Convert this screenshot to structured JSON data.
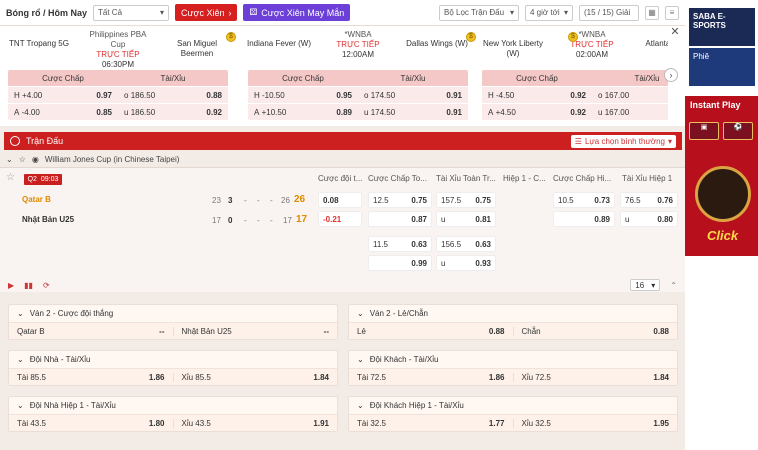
{
  "topbar": {
    "breadcrumb": "Bóng rổ / Hôm Nay",
    "filter_all": "Tất Cả",
    "parlay_btn": "Cược Xiên",
    "lucky_parlay_btn": "Cược Xiên May Mắn",
    "match_filter": "Bộ Lọc Trận Đấu",
    "hours": "4 giờ tới",
    "league_count": "(15 / 15) Giải"
  },
  "featured": [
    {
      "league": "Philippines PBA Cup",
      "status": "TRỰC TIẾP",
      "time": "06:30PM",
      "home": "TNT Tropang 5G",
      "away": "San Miguel Beermen",
      "h1": "Cược Chấp",
      "h2": "Tài/Xỉu",
      "rows": [
        [
          "H",
          "+4.00",
          "0.97",
          "o",
          "186.50",
          "0.88"
        ],
        [
          "A",
          "-4.00",
          "0.85",
          "u",
          "186.50",
          "0.92"
        ]
      ]
    },
    {
      "league": "*WNBA",
      "status": "TRỰC TIẾP",
      "time": "12:00AM",
      "home": "Indiana Fever (W)",
      "away": "Dallas Wings (W)",
      "h1": "Cược Chấp",
      "h2": "Tài/Xỉu",
      "rows": [
        [
          "H",
          "-10.50",
          "0.95",
          "o",
          "174.50",
          "0.91"
        ],
        [
          "A",
          "+10.50",
          "0.89",
          "u",
          "174.50",
          "0.91"
        ]
      ]
    },
    {
      "league": "*WNBA",
      "status": "TRỰC TIẾP",
      "time": "02:00AM",
      "home": "New York Liberty (W)",
      "away": "Atlanta Dream",
      "h1": "Cược Chấp",
      "h2": "Tài/Xỉu",
      "rows": [
        [
          "H",
          "-4.50",
          "0.92",
          "o",
          "167.00",
          ""
        ],
        [
          "A",
          "+4.50",
          "0.92",
          "u",
          "167.00",
          ""
        ]
      ]
    }
  ],
  "section": {
    "title": "Trận Đấu",
    "sort": "Lựa chọn bình thường"
  },
  "league_name": "William Jones Cup (in Chinese Taipei)",
  "match": {
    "quarter": "Q2",
    "clock": "09:03",
    "cols": [
      "Cược đội t...",
      "Cược Chấp To...",
      "Tài Xỉu Toàn Tr...",
      "Hiệp 1 - C...",
      "Cược Chấp Hi...",
      "Tài Xỉu Hiệp 1"
    ],
    "home": {
      "name": "Qatar B",
      "q": [
        "23",
        "3",
        "-",
        "-",
        "-"
      ],
      "cur": "26",
      "total": "26"
    },
    "away": {
      "name": "Nhật Bản U25",
      "q": [
        "17",
        "0",
        "-",
        "-",
        "-"
      ],
      "cur": "17",
      "total": "17"
    },
    "ml": [
      "0.08",
      "-0.21"
    ],
    "hdp1": [
      [
        "12.5",
        "0.75"
      ],
      [
        "",
        "0.87"
      ]
    ],
    "ou1": [
      [
        "157.5",
        "0.75"
      ],
      [
        "u",
        "0.81"
      ]
    ],
    "hdp2": [
      [
        "11.5",
        "0.63"
      ],
      [
        "",
        "0.99"
      ]
    ],
    "ou2": [
      [
        "156.5",
        "0.63"
      ],
      [
        "u",
        "0.93"
      ]
    ],
    "h1hdp": [
      [
        "10.5",
        "0.73"
      ],
      [
        "",
        "0.89"
      ]
    ],
    "h1ou": [
      [
        "76.5",
        "0.76"
      ],
      [
        "u",
        "0.80"
      ]
    ],
    "page_size": "16"
  },
  "markets": [
    {
      "title": "Ván 2 - Cược đội thắng",
      "o1": [
        "Qatar B",
        "--"
      ],
      "o2": [
        "Nhật Bản U25",
        "--"
      ]
    },
    {
      "title": "Ván 2 - Lẻ/Chẵn",
      "o1": [
        "Lẻ",
        "0.88"
      ],
      "o2": [
        "Chẵn",
        "0.88"
      ]
    },
    {
      "title": "Đội Nhà - Tài/Xỉu",
      "o1": [
        "Tài 85.5",
        "1.86"
      ],
      "o2": [
        "Xỉu 85.5",
        "1.84"
      ]
    },
    {
      "title": "Đội Khách - Tài/Xỉu",
      "o1": [
        "Tài 72.5",
        "1.86"
      ],
      "o2": [
        "Xỉu 72.5",
        "1.84"
      ]
    },
    {
      "title": "Đội Nhà Hiệp 1 - Tài/Xỉu",
      "o1": [
        "Tài 43.5",
        "1.80"
      ],
      "o2": [
        "Xỉu 43.5",
        "1.91"
      ]
    },
    {
      "title": "Đội Khách Hiệp 1 - Tài/Xỉu",
      "o1": [
        "Tài 32.5",
        "1.77"
      ],
      "o2": [
        "Xỉu 32.5",
        "1.95"
      ]
    }
  ],
  "ads": {
    "saba": "SABA E-SPORTS",
    "ad2": "Phiê",
    "instant": "Instant Play",
    "click": "Click"
  },
  "colors": {
    "red": "#d61f1f",
    "purple": "#6c3fd8",
    "accent_orange": "#e08a00"
  }
}
